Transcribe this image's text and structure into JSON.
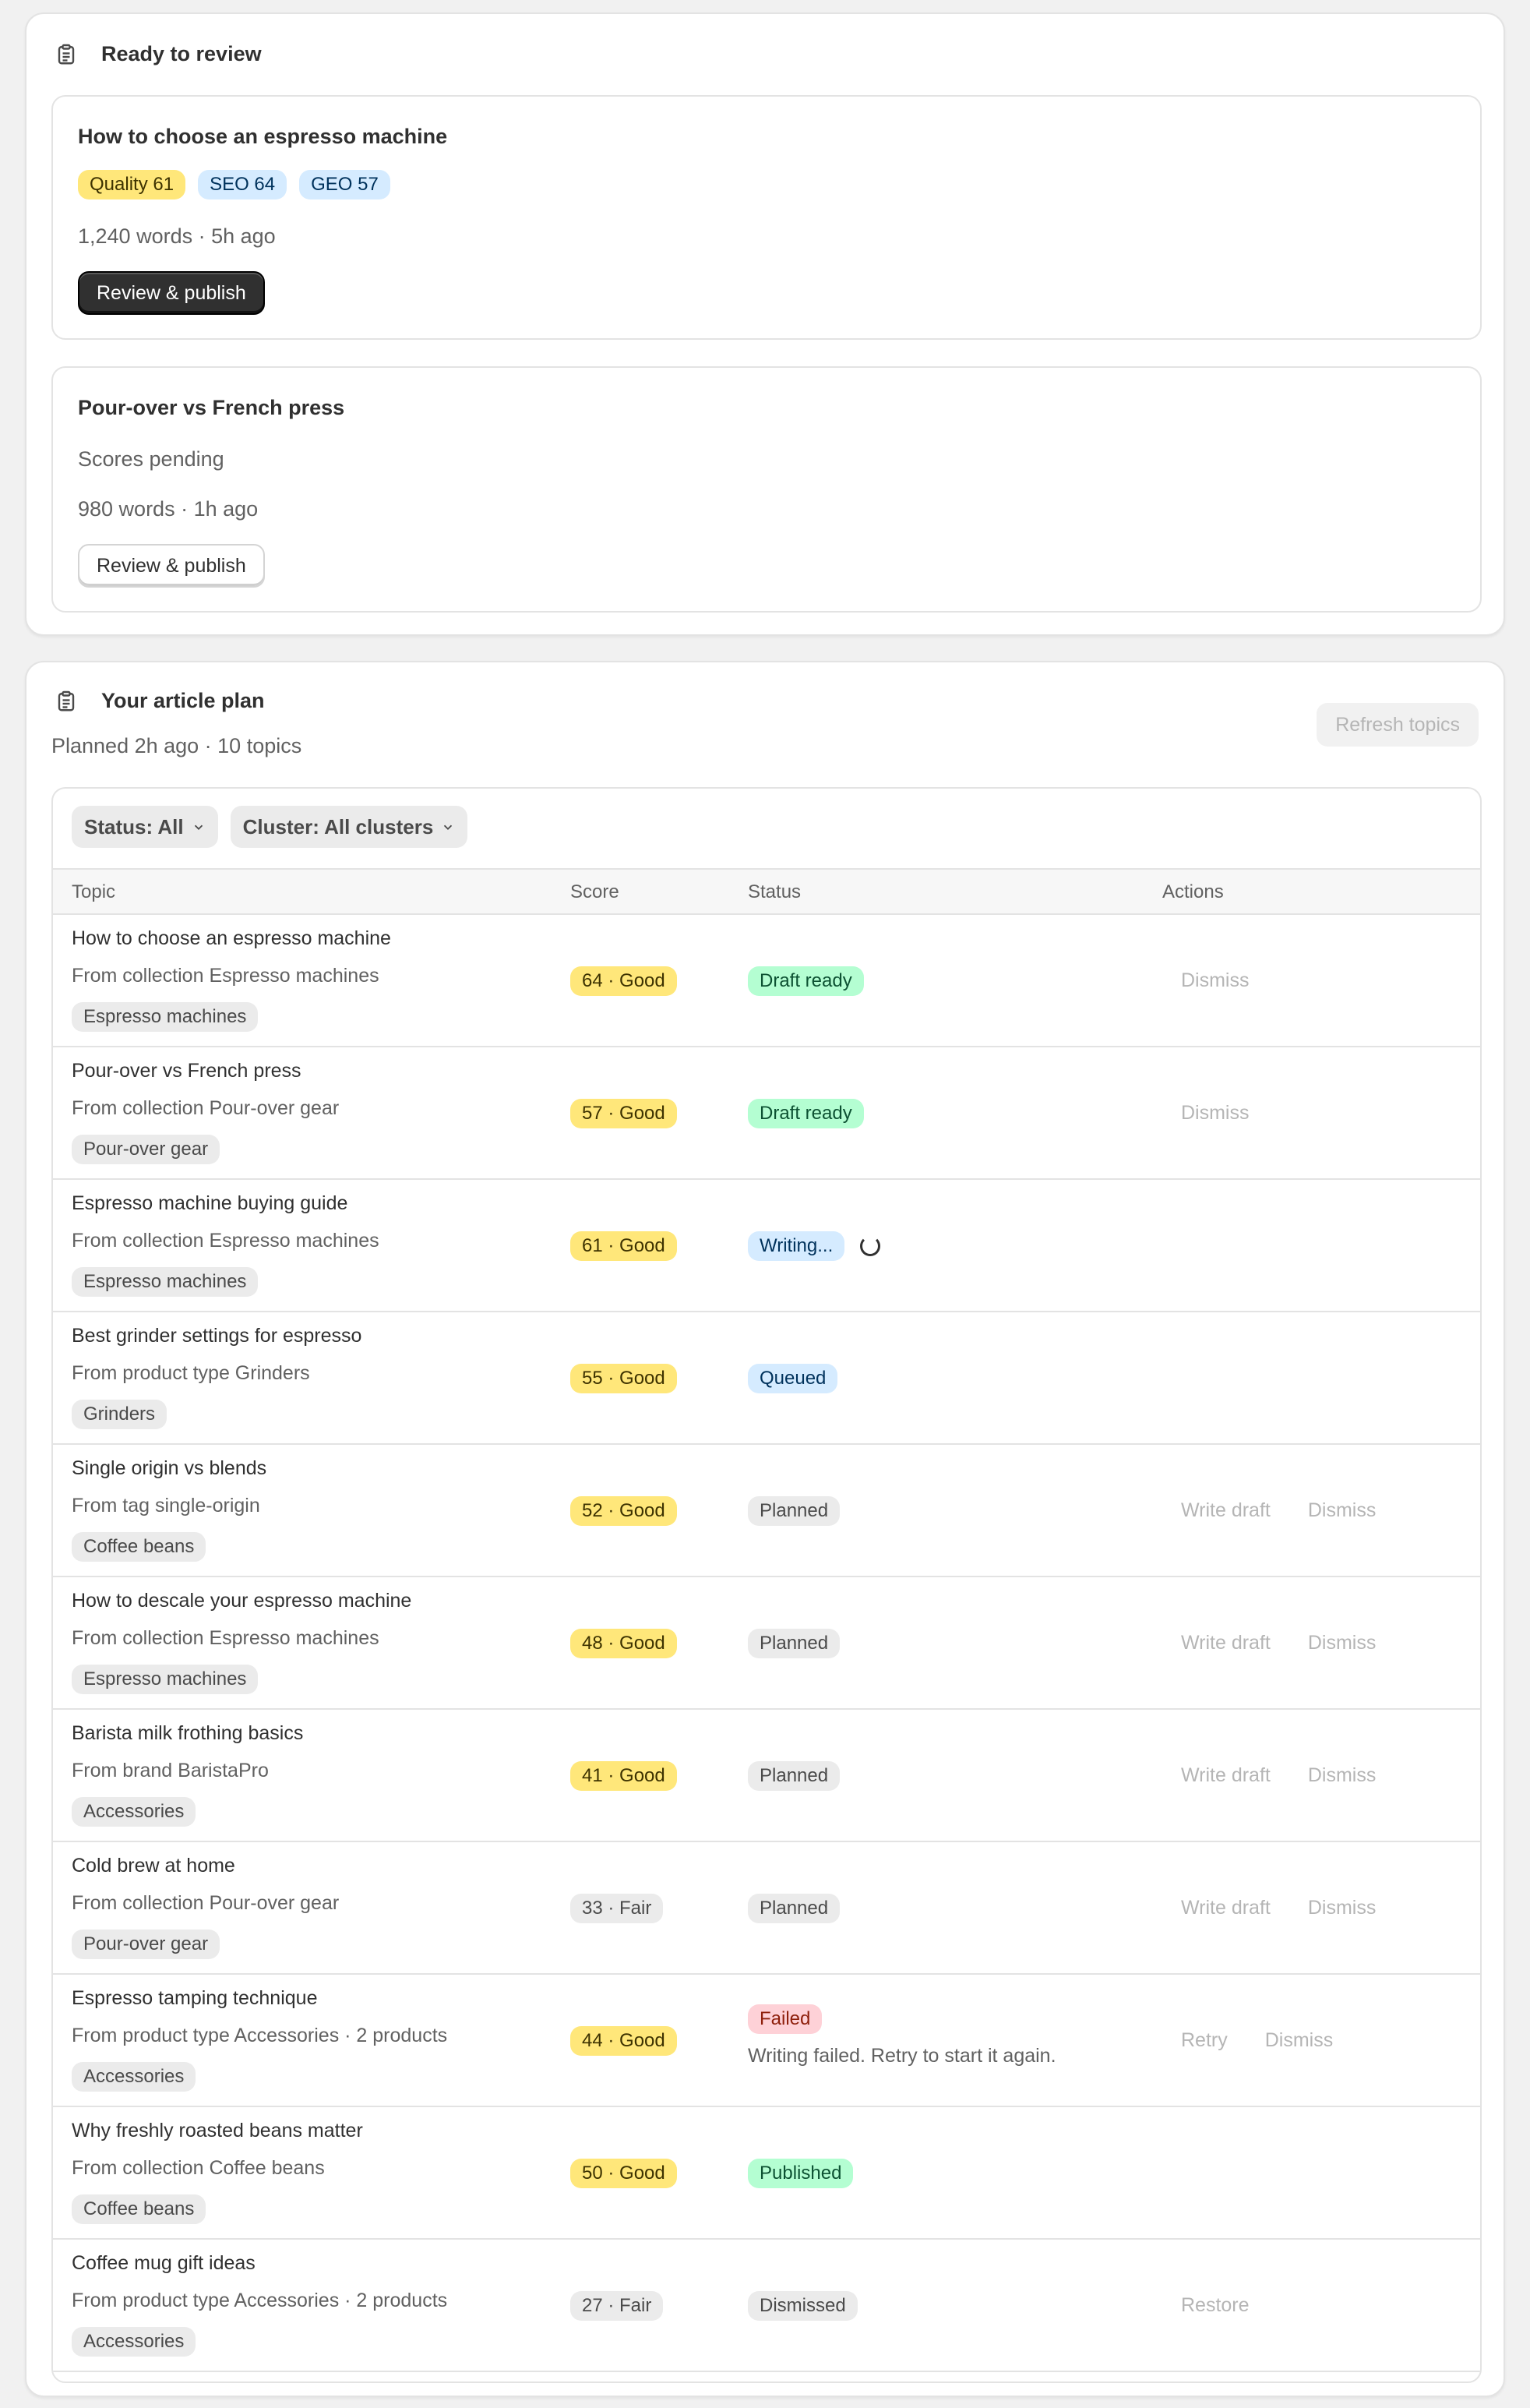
{
  "review": {
    "title": "Ready to review",
    "articles": [
      {
        "title": "How to choose an espresso machine",
        "badges": [
          {
            "label": "Quality 61",
            "tone": "yellow"
          },
          {
            "label": "SEO 64",
            "tone": "blue"
          },
          {
            "label": "GEO 57",
            "tone": "blue"
          }
        ],
        "meta": "1,240 words · 5h ago",
        "button": "Review & publish"
      },
      {
        "title": "Pour-over vs French press",
        "scores_text": "Scores pending",
        "meta": "980 words · 1h ago",
        "button": "Review & publish"
      }
    ]
  },
  "plan": {
    "title": "Your article plan",
    "subtitle": "Planned 2h ago · 10 topics",
    "refresh_button": "Refresh topics",
    "filters": {
      "status": "Status: All",
      "cluster": "Cluster: All clusters"
    },
    "columns": [
      "Topic",
      "Score",
      "Status",
      "Actions"
    ],
    "rows": [
      {
        "topic": "How to choose an espresso machine",
        "source": "From collection Espresso machines",
        "tag": "Espresso machines",
        "score": "64 · Good",
        "score_tone": "yellow",
        "status": "Draft ready",
        "status_tone": "green",
        "actions": [
          "Dismiss"
        ]
      },
      {
        "topic": "Pour-over vs French press",
        "source": "From collection Pour-over gear",
        "tag": "Pour-over gear",
        "score": "57 · Good",
        "score_tone": "yellow",
        "status": "Draft ready",
        "status_tone": "green",
        "actions": [
          "Dismiss"
        ]
      },
      {
        "topic": "Espresso machine buying guide",
        "source": "From collection Espresso machines",
        "tag": "Espresso machines",
        "score": "61 · Good",
        "score_tone": "yellow",
        "status": "Writing...",
        "status_tone": "blue",
        "actions": []
      },
      {
        "topic": "Best grinder settings for espresso",
        "source": "From product type Grinders",
        "tag": "Grinders",
        "score": "55 · Good",
        "score_tone": "yellow",
        "status": "Queued",
        "status_tone": "blue",
        "actions": []
      },
      {
        "topic": "Single origin vs blends",
        "source": "From tag single-origin",
        "tag": "Coffee beans",
        "score": "52 · Good",
        "score_tone": "yellow",
        "status": "Planned",
        "status_tone": "gray",
        "actions": [
          "Write draft",
          "Dismiss"
        ]
      },
      {
        "topic": "How to descale your espresso machine",
        "source": "From collection Espresso machines",
        "tag": "Espresso machines",
        "score": "48 · Good",
        "score_tone": "yellow",
        "status": "Planned",
        "status_tone": "gray",
        "actions": [
          "Write draft",
          "Dismiss"
        ]
      },
      {
        "topic": "Barista milk frothing basics",
        "source": "From brand BaristaPro",
        "tag": "Accessories",
        "score": "41 · Good",
        "score_tone": "yellow",
        "status": "Planned",
        "status_tone": "gray",
        "actions": [
          "Write draft",
          "Dismiss"
        ]
      },
      {
        "topic": "Cold brew at home",
        "source": "From collection Pour-over gear",
        "tag": "Pour-over gear",
        "score": "33 · Fair",
        "score_tone": "gray",
        "status": "Planned",
        "status_tone": "gray",
        "actions": [
          "Write draft",
          "Dismiss"
        ]
      },
      {
        "topic": "Espresso tamping technique",
        "source": "From product type Accessories · 2 products",
        "tag": "Accessories",
        "score": "44 · Good",
        "score_tone": "yellow",
        "status": "Failed",
        "status_tone": "red",
        "status_note": "Writing failed. Retry to start it again.",
        "actions": [
          "Retry",
          "Dismiss"
        ]
      },
      {
        "topic": "Why freshly roasted beans matter",
        "source": "From collection Coffee beans",
        "tag": "Coffee beans",
        "score": "50 · Good",
        "score_tone": "yellow",
        "status": "Published",
        "status_tone": "green",
        "actions": []
      },
      {
        "topic": "Coffee mug gift ideas",
        "source": "From product type Accessories · 2 products",
        "tag": "Accessories",
        "score": "27 · Fair",
        "score_tone": "gray",
        "status": "Dismissed",
        "status_tone": "gray",
        "actions": [
          "Restore"
        ]
      }
    ]
  }
}
